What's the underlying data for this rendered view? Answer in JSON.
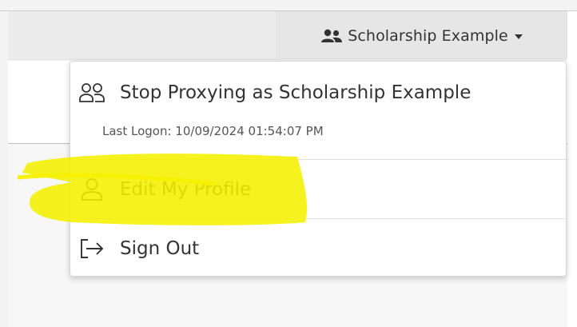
{
  "header": {
    "user_menu": {
      "label": "Scholarship Example",
      "icon": "users-icon"
    }
  },
  "dropdown": {
    "items": [
      {
        "label": "Stop Proxying as Scholarship Example",
        "icon": "users-outline-icon"
      },
      {
        "label": "Edit My Profile",
        "icon": "user-outline-icon"
      },
      {
        "label": "Sign Out",
        "icon": "sign-out-icon"
      }
    ],
    "last_logon": "Last Logon: 10/09/2024 01:54:07 PM"
  },
  "annotation": {
    "highlight_color": "#f5f000"
  },
  "colors": {
    "text": "#333333",
    "navbar_bg": "#ececec",
    "toggle_bg": "#e6e6e6"
  }
}
